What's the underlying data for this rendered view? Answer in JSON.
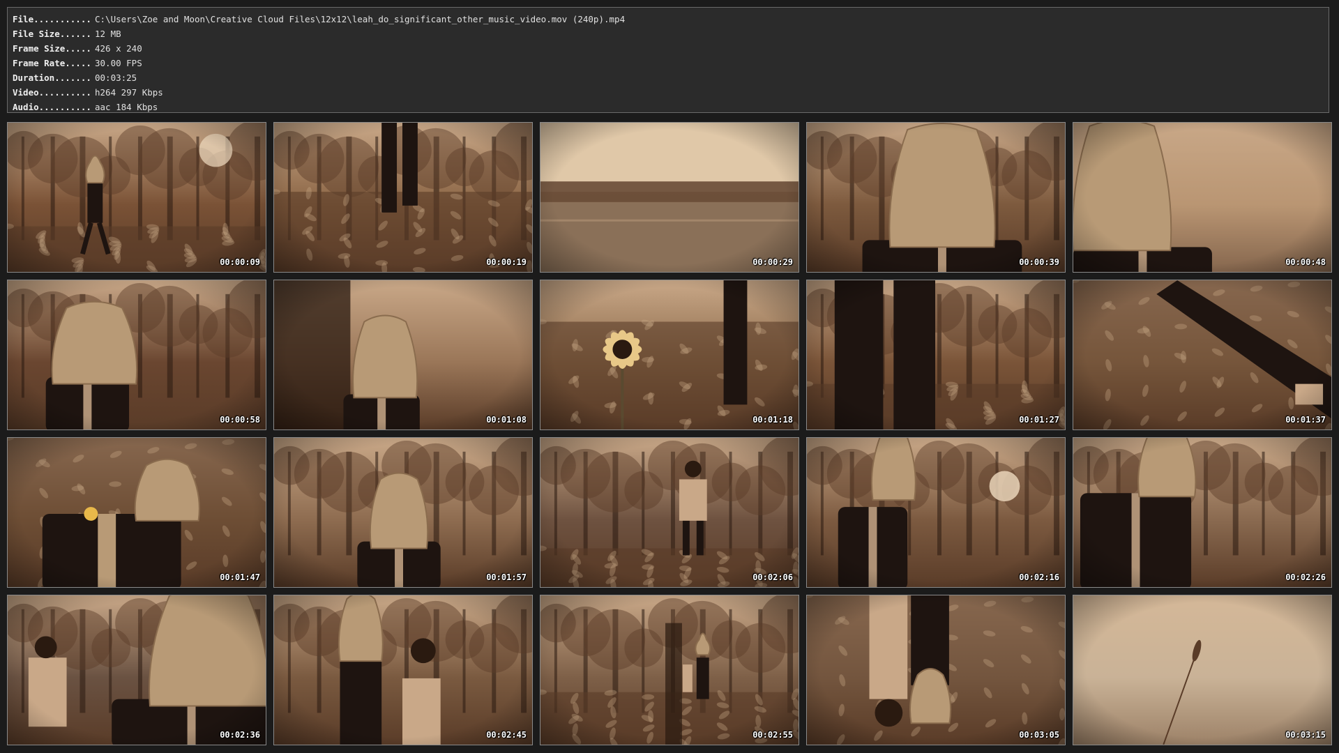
{
  "info": {
    "rows": [
      {
        "key": "File...........",
        "value": "C:\\Users\\Zoe and Moon\\Creative Cloud Files\\12x12\\leah_do_significant_other_music_video.mov (240p).mp4"
      },
      {
        "key": "File Size......",
        "value": "12 MB"
      },
      {
        "key": "Frame Size.....",
        "value": "426 x 240"
      },
      {
        "key": "Frame Rate.....",
        "value": "30.00 FPS"
      },
      {
        "key": "Duration.......",
        "value": "00:03:25"
      },
      {
        "key": "Video..........",
        "value": "h264 297 Kbps"
      },
      {
        "key": "Audio..........",
        "value": "aac 184 Kbps"
      }
    ]
  },
  "thumbnails": [
    {
      "time": "00:00:09",
      "scene": "forest-walk",
      "tone": "#7a5236"
    },
    {
      "time": "00:00:19",
      "scene": "legs-grass",
      "tone": "#8a6444"
    },
    {
      "time": "00:00:29",
      "scene": "lake",
      "tone": "#b49a7e"
    },
    {
      "time": "00:00:39",
      "scene": "bag-head-close",
      "tone": "#7d5a3e"
    },
    {
      "time": "00:00:48",
      "scene": "bag-head-side",
      "tone": "#b08a66"
    },
    {
      "time": "00:00:58",
      "scene": "bag-head-forest",
      "tone": "#6a4630"
    },
    {
      "time": "00:01:08",
      "scene": "bag-head-tree",
      "tone": "#9a7658"
    },
    {
      "time": "00:01:18",
      "scene": "sunflower",
      "tone": "#8c6a4a"
    },
    {
      "time": "00:01:27",
      "scene": "legs-closeup",
      "tone": "#7a5438"
    },
    {
      "time": "00:01:37",
      "scene": "arm-leaves",
      "tone": "#a07c58"
    },
    {
      "time": "00:01:47",
      "scene": "lying-leaves",
      "tone": "#8a6848"
    },
    {
      "time": "00:01:57",
      "scene": "bag-head-trees",
      "tone": "#8e6c50"
    },
    {
      "time": "00:02:06",
      "scene": "woman-forest",
      "tone": "#6e5240"
    },
    {
      "time": "00:02:16",
      "scene": "bag-head-sun",
      "tone": "#7c5a40"
    },
    {
      "time": "00:02:26",
      "scene": "bag-head-suit",
      "tone": "#8a6a50"
    },
    {
      "time": "00:02:36",
      "scene": "bag-head-woman",
      "tone": "#6a5242"
    },
    {
      "time": "00:02:45",
      "scene": "couple-forest",
      "tone": "#7a5a40"
    },
    {
      "time": "00:02:55",
      "scene": "couple-distance",
      "tone": "#7e6048"
    },
    {
      "time": "00:03:05",
      "scene": "couple-lying",
      "tone": "#9a7c60"
    },
    {
      "time": "00:03:15",
      "scene": "grass-stalk",
      "tone": "#b39d86"
    }
  ]
}
